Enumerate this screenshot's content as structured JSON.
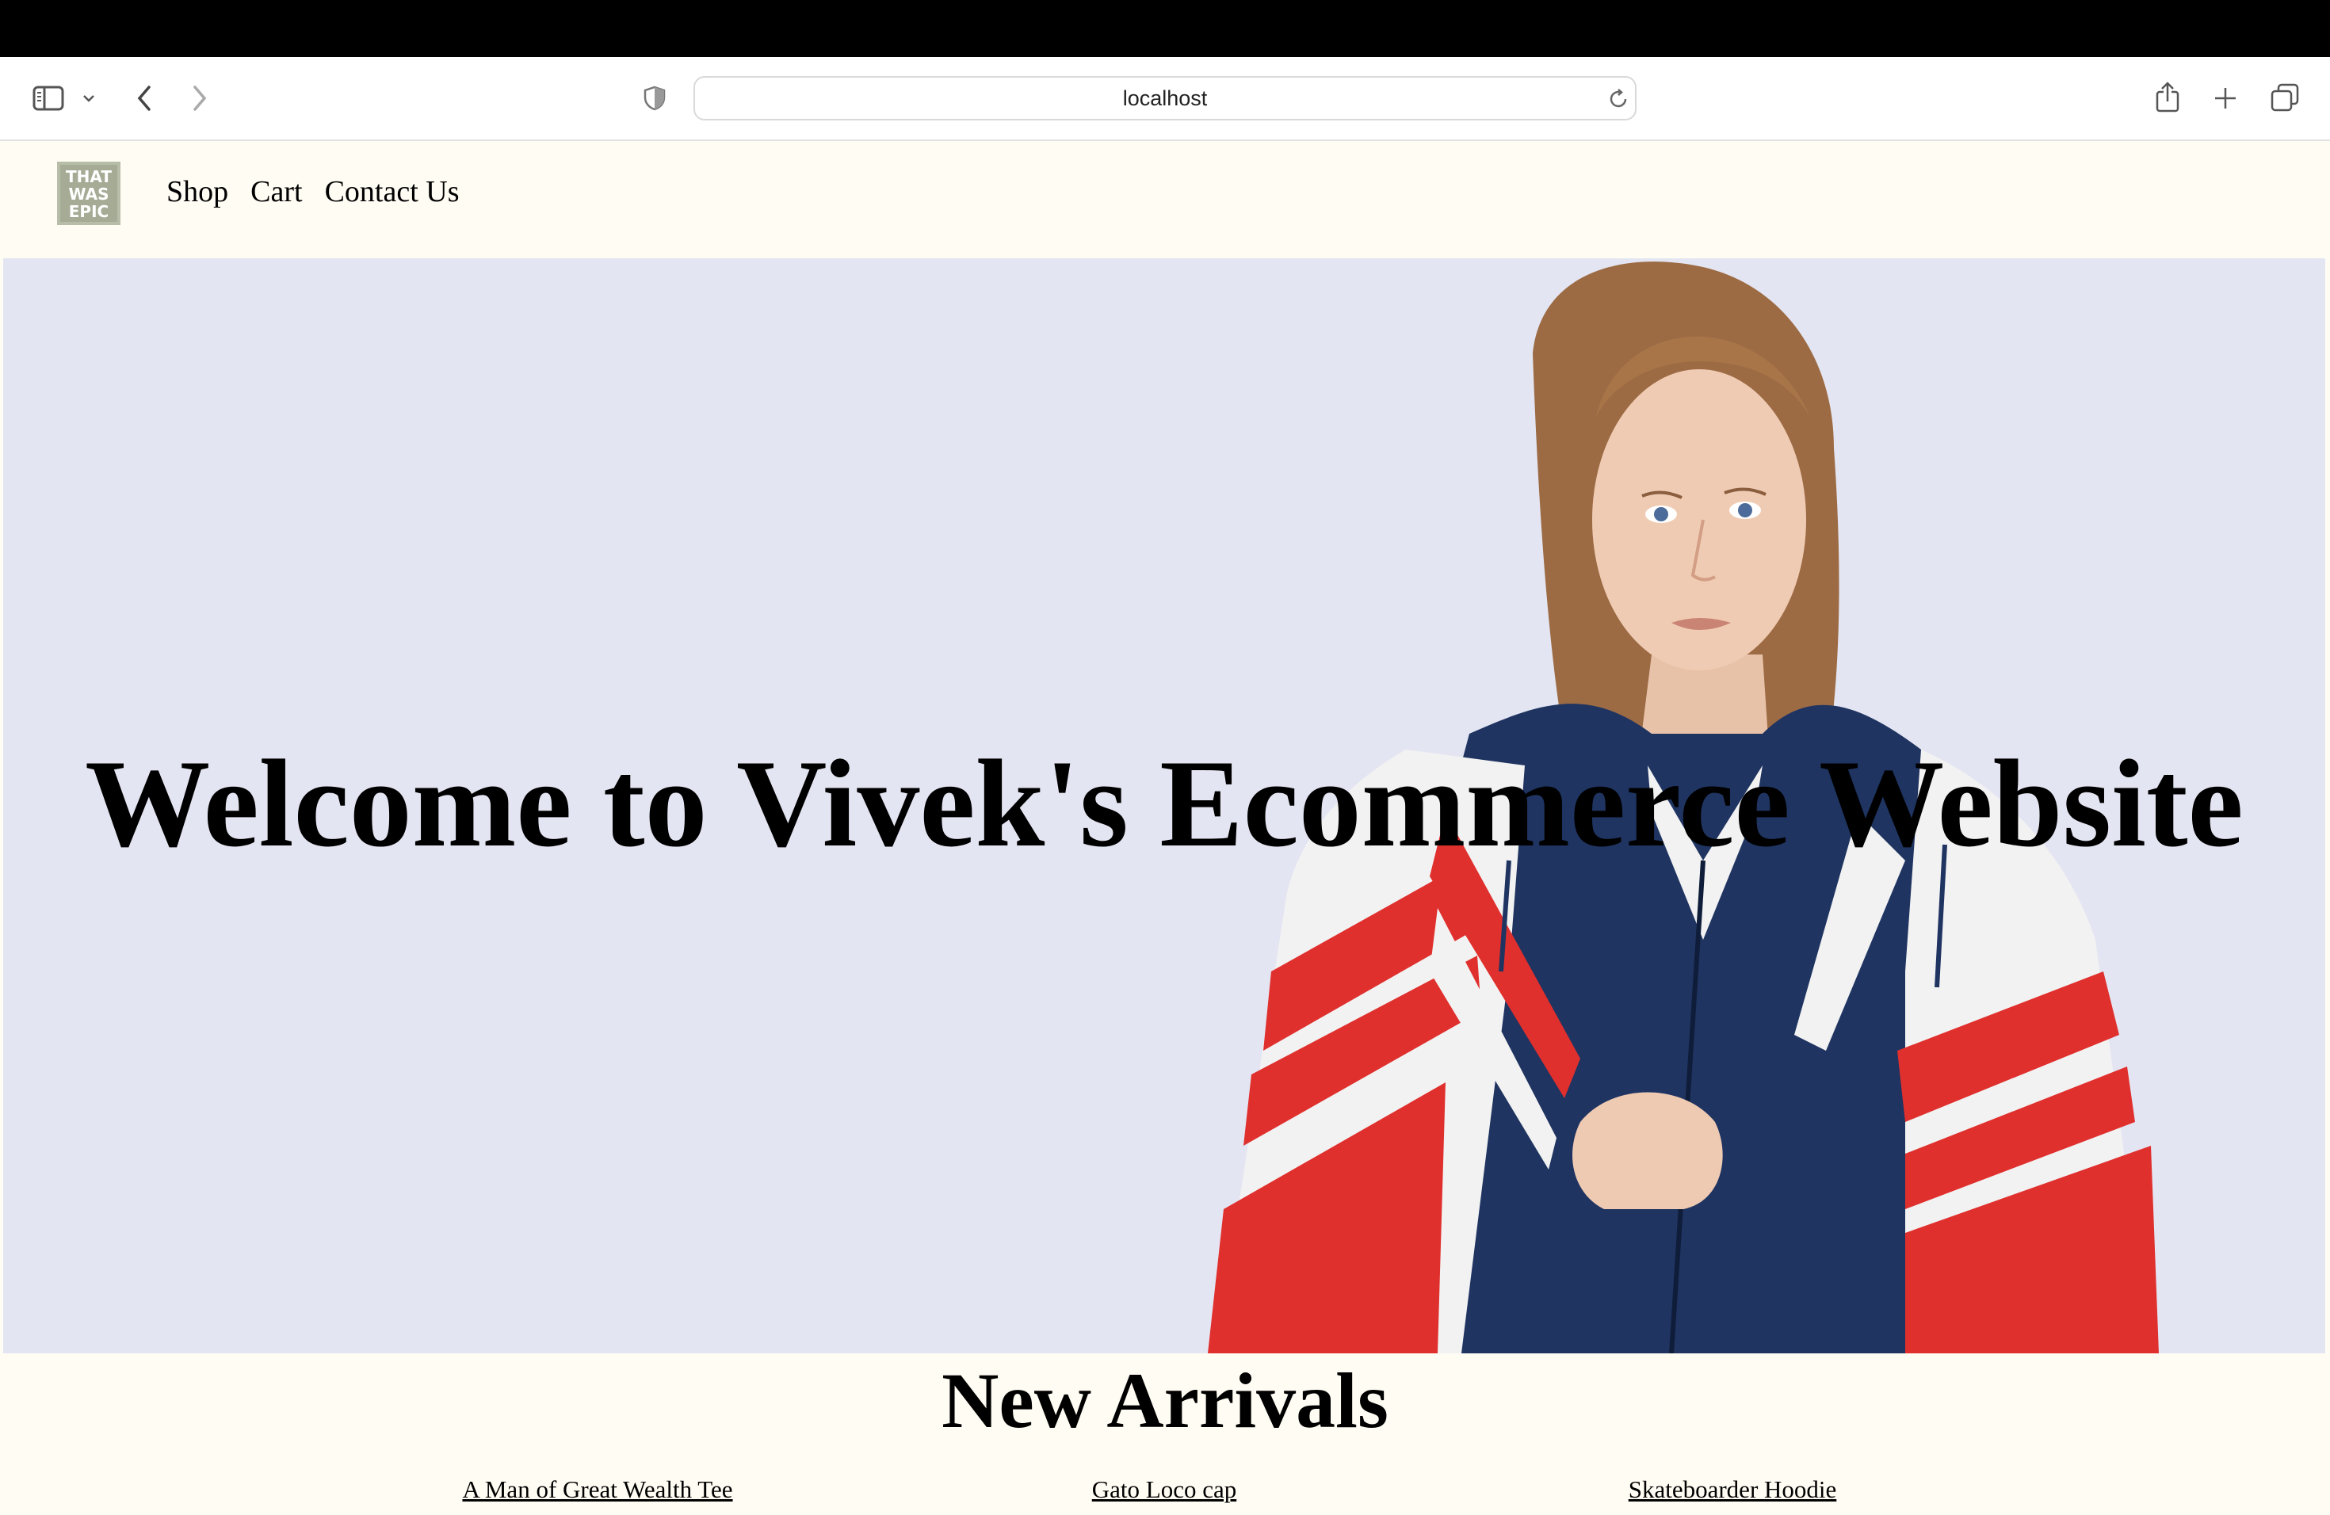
{
  "browser": {
    "address": "localhost"
  },
  "header": {
    "logo_text": [
      "THAT",
      "WAS",
      "EPIC"
    ],
    "nav": [
      {
        "label": "Shop"
      },
      {
        "label": "Cart"
      },
      {
        "label": "Contact Us"
      }
    ]
  },
  "hero": {
    "title": "Welcome to Vivek's Ecommerce Website"
  },
  "new_arrivals": {
    "title": "New Arrivals",
    "products": [
      {
        "name": "A Man of Great Wealth Tee"
      },
      {
        "name": "Gato Loco cap"
      },
      {
        "name": "Skateboarder Hoodie"
      }
    ]
  },
  "colors": {
    "page_bg": "#fffcf3",
    "hero_bg": "#e4e5f2",
    "jacket_navy": "#1f3461",
    "jacket_red": "#e0302e",
    "jacket_white": "#f2f2f2"
  }
}
